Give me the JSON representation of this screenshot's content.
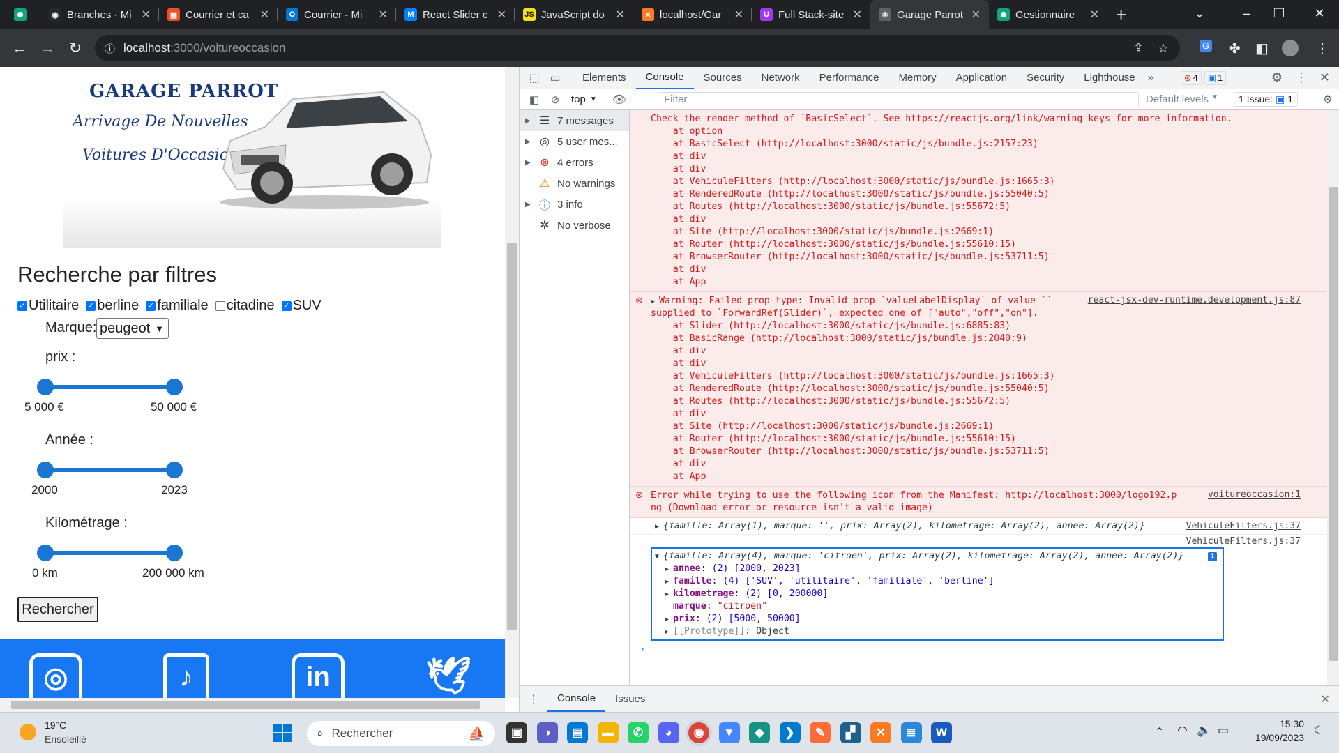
{
  "browser": {
    "tabs": [
      {
        "title": "Branches · Mi",
        "icon": "github-icon",
        "color": "#24292f",
        "glyph": "◉"
      },
      {
        "title": "Courrier et ca",
        "icon": "microsoft-icon",
        "color": "#f25022",
        "glyph": "▦"
      },
      {
        "title": "Courrier - Mi",
        "icon": "outlook-icon",
        "color": "#0078d4",
        "glyph": "O"
      },
      {
        "title": "React Slider c",
        "icon": "mui-icon",
        "color": "#007fff",
        "glyph": "M"
      },
      {
        "title": "JavaScript do",
        "icon": "js-icon",
        "color": "#f7df1e",
        "glyph": "JS"
      },
      {
        "title": "localhost/Gar",
        "icon": "xampp-icon",
        "color": "#fb7a24",
        "glyph": "✕"
      },
      {
        "title": "Full Stack-site",
        "icon": "udemy-icon",
        "color": "#a435f0",
        "glyph": "U"
      },
      {
        "title": "Garage Parrot",
        "icon": "react-icon",
        "color": "#5f6368",
        "glyph": "⚛",
        "active": true
      },
      {
        "title": "Gestionnaire",
        "icon": "chatgpt-icon",
        "color": "#10a37f",
        "glyph": "✺"
      }
    ],
    "url_host": "localhost",
    "url_path": ":3000/voitureoccasion"
  },
  "site": {
    "logo_title": "GARAGE PARROT",
    "logo_line1": "Arrivage De Nouvelles",
    "logo_line2": "Voitures D'Occasion",
    "filters_title": "Recherche par filtres",
    "checkboxes": [
      {
        "label": "Utilitaire",
        "checked": true
      },
      {
        "label": "berline",
        "checked": true
      },
      {
        "label": "familiale",
        "checked": true
      },
      {
        "label": "citadine",
        "checked": false
      },
      {
        "label": "SUV",
        "checked": true
      }
    ],
    "marque_label": "Marque:",
    "marque_value": "peugeot",
    "prix_label": "prix :",
    "prix_min": "5 000 €",
    "prix_max": "50 000 €",
    "annee_label": "Année :",
    "annee_min": "2000",
    "annee_max": "2023",
    "km_label": "Kilométrage :",
    "km_min": "0 km",
    "km_max": "200 000 km",
    "search_button": "Rechercher"
  },
  "devtools": {
    "tabs": [
      "Elements",
      "Console",
      "Sources",
      "Network",
      "Performance",
      "Memory",
      "Application",
      "Security",
      "Lighthouse"
    ],
    "active_tab": "Console",
    "error_count": "4",
    "message_count": "1",
    "context": "top",
    "filter_placeholder": "Filter",
    "levels": "Default levels",
    "issues": "1 Issue:",
    "issues_count": "1",
    "sidebar": [
      {
        "label": "7 messages",
        "icon": "list-icon",
        "glyph": "☰"
      },
      {
        "label": "5 user mes...",
        "icon": "user-icon",
        "glyph": "◎"
      },
      {
        "label": "4 errors",
        "icon": "error-icon",
        "glyph": "⊗"
      },
      {
        "label": "No warnings",
        "icon": "warning-icon",
        "glyph": "⚠"
      },
      {
        "label": "3 info",
        "icon": "info-icon",
        "glyph": "ⓘ"
      },
      {
        "label": "No verbose",
        "icon": "bug-icon",
        "glyph": "✲"
      }
    ],
    "err1_lines": [
      "Check the render method of `BasicSelect`. See https://reactjs.org/link/warning-keys for more information.",
      "    at option",
      "    at BasicSelect (http://localhost:3000/static/js/bundle.js:2157:23)",
      "    at div",
      "    at div",
      "    at VehiculeFilters (http://localhost:3000/static/js/bundle.js:1665:3)",
      "    at RenderedRoute (http://localhost:3000/static/js/bundle.js:55040:5)",
      "    at Routes (http://localhost:3000/static/js/bundle.js:55672:5)",
      "    at div",
      "    at Site (http://localhost:3000/static/js/bundle.js:2669:1)",
      "    at Router (http://localhost:3000/static/js/bundle.js:55610:15)",
      "    at BrowserRouter (http://localhost:3000/static/js/bundle.js:53711:5)",
      "    at div",
      "    at App"
    ],
    "err2_lines": [
      "Warning: Failed prop type: Invalid prop `valueLabelDisplay` of value ``",
      "supplied to `ForwardRef(Slider)`, expected one of [\"auto\",\"off\",\"on\"].",
      "    at Slider (http://localhost:3000/static/js/bundle.js:6885:83)",
      "    at BasicRange (http://localhost:3000/static/js/bundle.js:2040:9)",
      "    at div",
      "    at div",
      "    at VehiculeFilters (http://localhost:3000/static/js/bundle.js:1665:3)",
      "    at RenderedRoute (http://localhost:3000/static/js/bundle.js:55040:5)",
      "    at Routes (http://localhost:3000/static/js/bundle.js:55672:5)",
      "    at div",
      "    at Site (http://localhost:3000/static/js/bundle.js:2669:1)",
      "    at Router (http://localhost:3000/static/js/bundle.js:55610:15)",
      "    at BrowserRouter (http://localhost:3000/static/js/bundle.js:53711:5)",
      "    at div",
      "    at App"
    ],
    "err2_source": "react-jsx-dev-runtime.development.js:87",
    "err3_lines": [
      "Error while trying to use the following icon from the Manifest: http://localhost:3000/logo192.p",
      "ng (Download error or resource isn't a valid image)"
    ],
    "err3_source": "voitureoccasion:1",
    "log1": "{famille: Array(1), marque: '', prix: Array(2), kilometrage: Array(2), annee: Array(2)}",
    "log1_source": "VehiculeFilters.js:37",
    "log2_source": "VehiculeFilters.js:37",
    "log2": "{famille: Array(4), marque: 'citroen', prix: Array(2), kilometrage: Array(2), annee: Array(2)}",
    "props": [
      {
        "key": "annee",
        "val": "(2) [2000, 2023]",
        "expand": true
      },
      {
        "key": "famille",
        "val": "(4) ['SUV', 'utilitaire', 'familiale', 'berline']",
        "expand": true
      },
      {
        "key": "kilometrage",
        "val": "(2) [0, 200000]",
        "expand": true
      },
      {
        "key": "marque",
        "val": "\"citroen\"",
        "expand": false
      },
      {
        "key": "prix",
        "val": "(2) [5000, 50000]",
        "expand": true
      },
      {
        "key": "[[Prototype]]",
        "val": "Object",
        "expand": true
      }
    ],
    "drawer_tabs": [
      "Console",
      "Issues"
    ]
  },
  "taskbar": {
    "temp": "19°C",
    "weather": "Ensoleillé",
    "search_placeholder": "Rechercher",
    "time": "15:30",
    "date": "19/09/2023",
    "apps": [
      {
        "name": "taskview-icon",
        "color": "#333",
        "glyph": "▣"
      },
      {
        "name": "teams-icon",
        "color": "#5b5fc7",
        "glyph": "◑"
      },
      {
        "name": "store-icon",
        "color": "#0078d4",
        "glyph": "▤"
      },
      {
        "name": "explorer-icon",
        "color": "#f4b400",
        "glyph": "▬"
      },
      {
        "name": "whatsapp-icon",
        "color": "#25d366",
        "glyph": "✆"
      },
      {
        "name": "discord-icon",
        "color": "#5865f2",
        "glyph": "◕"
      },
      {
        "name": "chrome-icon",
        "color": "#db4437",
        "glyph": "◉"
      },
      {
        "name": "nordvpn-icon",
        "color": "#4687ff",
        "glyph": "▼"
      },
      {
        "name": "gitkraken-icon",
        "color": "#179287",
        "glyph": "◆"
      },
      {
        "name": "vscode-icon",
        "color": "#007acc",
        "glyph": "❯"
      },
      {
        "name": "postman-icon",
        "color": "#ff6c37",
        "glyph": "✎"
      },
      {
        "name": "mysql-icon",
        "color": "#1e5f8c",
        "glyph": "▞"
      },
      {
        "name": "xampp-icon",
        "color": "#fb7a24",
        "glyph": "✕"
      },
      {
        "name": "notepad-icon",
        "color": "#2b88d8",
        "glyph": "≣"
      },
      {
        "name": "word-icon",
        "color": "#185abd",
        "glyph": "W"
      }
    ]
  }
}
